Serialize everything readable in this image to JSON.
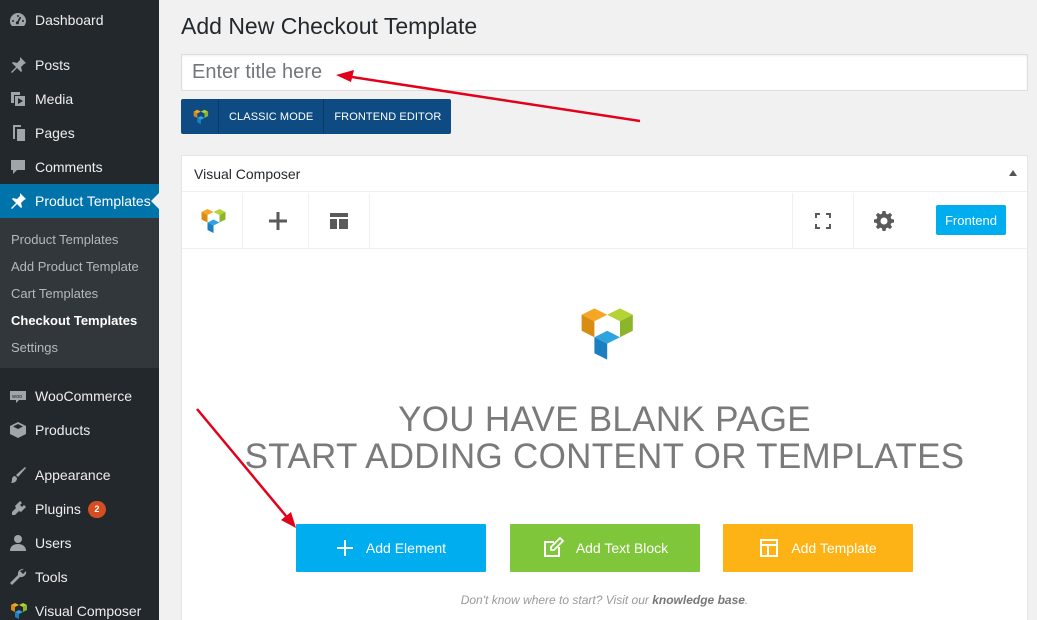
{
  "sidebar": {
    "top_items": [
      {
        "label": "Dashboard",
        "icon": "dashboard-icon"
      },
      {
        "label": "Posts",
        "icon": "pin-icon"
      },
      {
        "label": "Media",
        "icon": "media-icon"
      },
      {
        "label": "Pages",
        "icon": "pages-icon"
      },
      {
        "label": "Comments",
        "icon": "comments-icon"
      },
      {
        "label": "Product Templates",
        "icon": "pin-icon"
      }
    ],
    "submenu": [
      {
        "label": "Product Templates"
      },
      {
        "label": "Add Product Template"
      },
      {
        "label": "Cart Templates"
      },
      {
        "label": "Checkout Templates"
      },
      {
        "label": "Settings"
      }
    ],
    "bottom_items": [
      {
        "label": "WooCommerce",
        "icon": "woocommerce-icon"
      },
      {
        "label": "Products",
        "icon": "box-icon"
      },
      {
        "label": "Appearance",
        "icon": "brush-icon"
      },
      {
        "label": "Plugins",
        "icon": "plugin-icon",
        "badge": "2"
      },
      {
        "label": "Users",
        "icon": "user-icon"
      },
      {
        "label": "Tools",
        "icon": "wrench-icon"
      },
      {
        "label": "Visual Composer",
        "icon": "vc-logo-icon"
      }
    ]
  },
  "main": {
    "page_title": "Add New Checkout Template",
    "title_placeholder": "Enter title here",
    "mode_switch": {
      "classic": "CLASSIC MODE",
      "frontend": "FRONTEND EDITOR"
    }
  },
  "vc_panel": {
    "title": "Visual Composer",
    "frontend_button": "Frontend",
    "blank_line1": "YOU HAVE BLANK PAGE",
    "blank_line2": "START ADDING CONTENT OR TEMPLATES",
    "add_element": "Add Element",
    "add_text_block": "Add Text Block",
    "add_template": "Add Template",
    "help_prefix": "Don't know where to start? Visit our",
    "help_link": "knowledge base",
    "help_suffix": "."
  },
  "colors": {
    "sidebar_bg": "#23282d",
    "active_item": "#0073aa",
    "vc_blue": "#00aef0",
    "vc_green": "#7fc63a",
    "vc_orange": "#fdb215",
    "annotation_red": "#e2001a"
  }
}
